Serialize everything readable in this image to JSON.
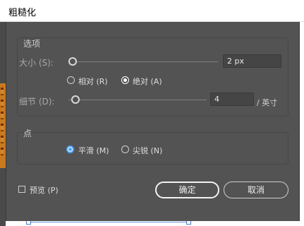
{
  "window": {
    "title": "粗糙化"
  },
  "options_group": {
    "title": "选项",
    "size": {
      "label": "大小 (S):",
      "value": "2 px"
    },
    "mode": {
      "relative_label": "相对 (R)",
      "absolute_label": "绝对 (A)",
      "selected": "absolute"
    },
    "detail": {
      "label": "细节 (D):",
      "value": "4",
      "unit": "/ 英寸"
    }
  },
  "point_group": {
    "title": "点",
    "smooth_label": "平滑 (M)",
    "corner_label": "尖锐 (N)",
    "selected": "smooth"
  },
  "footer": {
    "preview_label": "预览 (P)",
    "preview_checked": false,
    "ok_label": "确定",
    "cancel_label": "取消"
  },
  "colors": {
    "dialog_bg": "#535353",
    "accent": "#4aa3ff"
  }
}
